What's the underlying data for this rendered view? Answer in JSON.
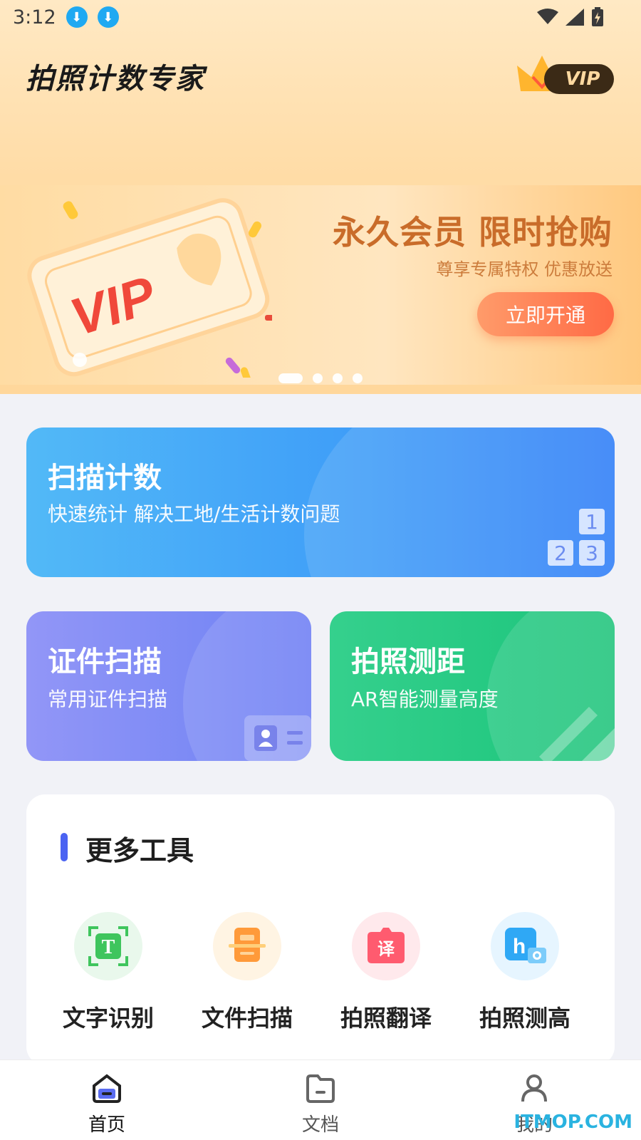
{
  "status_bar": {
    "time": "3:12"
  },
  "header": {
    "app_title": "拍照计数专家",
    "vip_label": "VIP"
  },
  "banner": {
    "ticket_text": "VIP",
    "title": "永久会员 限时抢购",
    "subtitle": "尊享专属特权 优惠放送",
    "button": "立即开通",
    "page_count": 4,
    "active_page": 1
  },
  "cards": {
    "scan_count": {
      "title": "扫描计数",
      "subtitle": "快速统计 解决工地/生活计数问题",
      "digits": [
        "1",
        "2",
        "3"
      ]
    },
    "id_scan": {
      "title": "证件扫描",
      "subtitle": "常用证件扫描"
    },
    "photo_distance": {
      "title": "拍照测距",
      "subtitle": "AR智能测量高度"
    }
  },
  "tools": {
    "title": "更多工具",
    "items": [
      {
        "label": "文字识别",
        "icon": "text-recognition-icon",
        "color": "#3fc55d"
      },
      {
        "label": "文件扫描",
        "icon": "document-scan-icon",
        "color": "#ff9a3a"
      },
      {
        "label": "拍照翻译",
        "icon": "translate-icon",
        "icon_text": "译",
        "color": "#ff5b6f"
      },
      {
        "label": "拍照测高",
        "icon": "height-measure-icon",
        "icon_text": "h",
        "color": "#2fa8f5"
      }
    ]
  },
  "nav": {
    "items": [
      {
        "label": "首页",
        "icon": "home-icon",
        "active": true
      },
      {
        "label": "文档",
        "icon": "folder-icon",
        "active": false
      },
      {
        "label": "我的",
        "icon": "profile-icon",
        "active": false
      }
    ]
  },
  "watermark": "ITMOP.COM",
  "colors": {
    "accent": "#4b63f2",
    "banner_button": "#ff6a45"
  }
}
